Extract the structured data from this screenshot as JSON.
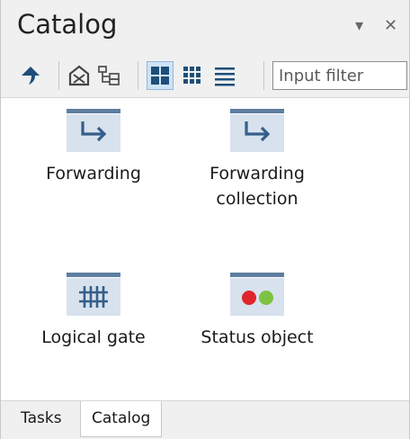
{
  "panel": {
    "title": "Catalog",
    "dropdown_icon": "chevron-down-icon",
    "close_icon": "close-icon",
    "dropdown_glyph": "▾",
    "close_glyph": "✕"
  },
  "toolbar": {
    "buttons": [
      {
        "icon": "up-arrow-icon"
      },
      {
        "icon": "home-catalog-icon"
      },
      {
        "icon": "tree-view-icon"
      },
      {
        "icon": "large-icons-view-icon",
        "selected": true
      },
      {
        "icon": "small-icons-view-icon"
      },
      {
        "icon": "list-view-icon"
      }
    ],
    "filter_placeholder": "Input filter"
  },
  "items": [
    {
      "label": "Forwarding",
      "icon": "forwarding-icon"
    },
    {
      "label": "Forwarding\ncollection",
      "icon": "forwarding-collection-icon"
    },
    {
      "label": "Logical gate",
      "icon": "logical-gate-icon"
    },
    {
      "label": "Status object",
      "icon": "status-object-icon"
    }
  ],
  "tabs": [
    {
      "label": "Tasks",
      "active": false
    },
    {
      "label": "Catalog",
      "active": true
    }
  ],
  "colors": {
    "icon_bar": "#5e7ea0",
    "icon_bg": "#d7e2ee",
    "status_red": "#e0262a",
    "status_green": "#7dc242",
    "selected_bg": "#cfe3f5"
  }
}
